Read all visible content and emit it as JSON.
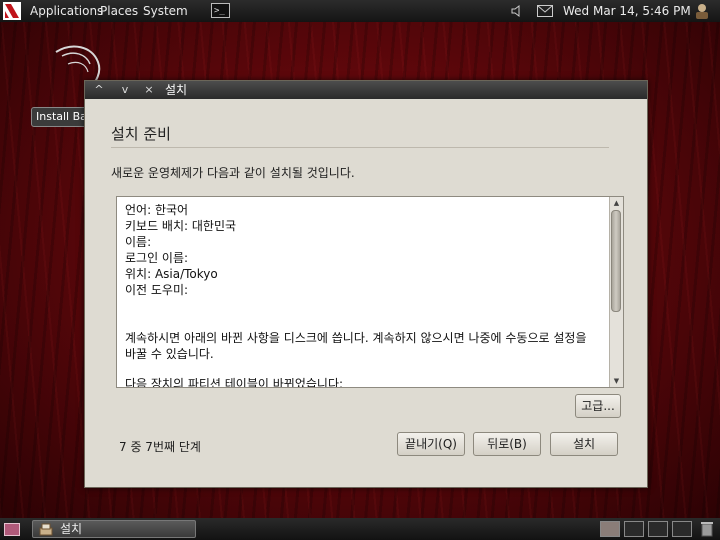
{
  "top_panel": {
    "menus": [
      "Applications",
      "Places",
      "System"
    ],
    "terminal_glyph": ">_",
    "clock": "Wed Mar 14,  5:46 PM"
  },
  "desktop": {
    "install_icon_label": "Install Ba"
  },
  "window": {
    "title": "설치",
    "controls": [
      "^",
      "v",
      "×"
    ],
    "heading": "설치 준비",
    "description": "새로운 운영체제가 다음과 같이 설치될 것입니다.",
    "summary_lines": [
      "언어: 한국어",
      "키보드 배치: 대한민국",
      "이름:",
      "로그인 이름:",
      "위치: Asia/Tokyo",
      "이전 도우미:"
    ],
    "summary_paragraph": "계속하시면 아래의 바뀐 사항을 디스크에 씁니다. 계속하지 않으시면 나중에 수동으로 설정을 바꿀 수 있습니다.",
    "summary_partial_line": "다음 장치의 파티션 테이블이 바뀌었습니다:",
    "advanced_button": "고급...",
    "step_text": "7 중 7번째 단계",
    "quit_button": "끝내기(Q)",
    "back_button": "뒤로(B)",
    "install_button": "설치"
  },
  "bottom_panel": {
    "task_label": "설치"
  },
  "colors": {
    "desktop_red": "#6e0a0e",
    "dialog_bg": "#dedbd2",
    "panel_dark": "#1e1e1e"
  }
}
